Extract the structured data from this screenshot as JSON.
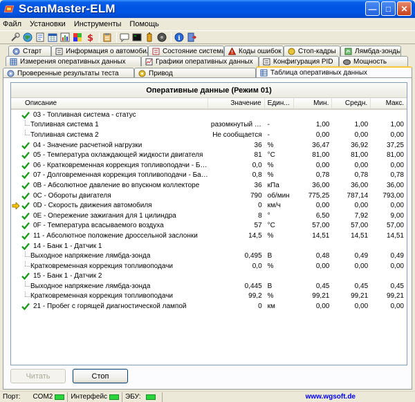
{
  "window": {
    "title": "ScanMaster-ELM"
  },
  "menu": [
    "Файл",
    "Установки",
    "Инструменты",
    "Помощь"
  ],
  "toolbar_icons": [
    "wrench-icon",
    "globe-icon",
    "document-icon",
    "calendar-icon",
    "chart-icon",
    "flag-icon",
    "dollar-icon",
    "separator",
    "clipboard-icon",
    "separator",
    "message-icon",
    "terminal-icon",
    "battery-icon",
    "record-icon",
    "separator",
    "info-icon",
    "exit-icon"
  ],
  "tabs": {
    "row1": [
      {
        "label": "Старт",
        "icon": "gear-icon"
      },
      {
        "label": "Информация о автомобиле",
        "icon": "car-icon"
      },
      {
        "label": "Состояние системы",
        "icon": "status-icon"
      },
      {
        "label": "Коды ошибок",
        "icon": "warning-icon"
      },
      {
        "label": "Стоп-кадры",
        "icon": "freeze-icon"
      },
      {
        "label": "Лямбда-зонды",
        "icon": "sensor-icon"
      }
    ],
    "row2": [
      {
        "label": "Измерения оперативных данных",
        "icon": "grid-icon"
      },
      {
        "label": "Графики оперативных данных",
        "icon": "graph-icon"
      },
      {
        "label": "Конфигурация PID",
        "icon": "config-icon"
      },
      {
        "label": "Мощность",
        "icon": "power-icon"
      }
    ],
    "row3": [
      {
        "label": "Проверенные результаты теста",
        "icon": "test-icon"
      },
      {
        "label": "Привод",
        "icon": "drive-icon"
      },
      {
        "label": "Таблица оперативных данных",
        "icon": "table-icon",
        "active": true
      }
    ]
  },
  "grid": {
    "title": "Оперативные данные (Режим 01)",
    "columns": [
      "Описание",
      "Значение",
      "Един...",
      "Мин.",
      "Средн.",
      "Макс."
    ],
    "rows": [
      {
        "level": 0,
        "check": true,
        "desc": "03 - Топливная система - статус",
        "val": "",
        "unit": "",
        "min": "",
        "avg": "",
        "max": ""
      },
      {
        "level": 1,
        "check": false,
        "desc": "Топливная система 1",
        "val": "разомкнутый к...",
        "unit": "-",
        "min": "1,00",
        "avg": "1,00",
        "max": "1,00"
      },
      {
        "level": 1,
        "check": false,
        "desc": "Топливная система 2",
        "val": "Не сообщается",
        "unit": "-",
        "min": "0,00",
        "avg": "0,00",
        "max": "0,00"
      },
      {
        "level": 0,
        "check": true,
        "desc": "04 - Значение расчетной нагрузки",
        "val": "36",
        "unit": "%",
        "min": "36,47",
        "avg": "36,92",
        "max": "37,25"
      },
      {
        "level": 0,
        "check": true,
        "desc": "05 - Температура охлаждающей жидкости двигателя",
        "val": "81",
        "unit": "°C",
        "min": "81,00",
        "avg": "81,00",
        "max": "81,00"
      },
      {
        "level": 0,
        "check": true,
        "desc": "06 - Кратковременная коррекция топливоподачи - Банк 1",
        "val": "0,0",
        "unit": "%",
        "min": "0,00",
        "avg": "0,00",
        "max": "0,00"
      },
      {
        "level": 0,
        "check": true,
        "desc": "07 - Долговременная коррекция топливоподачи - Банк 1",
        "val": "0,8",
        "unit": "%",
        "min": "0,78",
        "avg": "0,78",
        "max": "0,78"
      },
      {
        "level": 0,
        "check": true,
        "desc": "0B - Абсолютное давление во впускном коллекторе",
        "val": "36",
        "unit": "кПа",
        "min": "36,00",
        "avg": "36,00",
        "max": "36,00"
      },
      {
        "level": 0,
        "check": true,
        "desc": "0C - Обороты двигателя",
        "val": "790",
        "unit": "об/мин",
        "min": "775,25",
        "avg": "787,14",
        "max": "793,00"
      },
      {
        "level": 0,
        "check": true,
        "arrow": true,
        "desc": "0D - Скорость движения автомобиля",
        "val": "0",
        "unit": "км/ч",
        "min": "0,00",
        "avg": "0,00",
        "max": "0,00"
      },
      {
        "level": 0,
        "check": true,
        "desc": "0E - Опережение зажигания для 1 цилиндра",
        "val": "8",
        "unit": "°",
        "min": "6,50",
        "avg": "7,92",
        "max": "9,00"
      },
      {
        "level": 0,
        "check": true,
        "desc": "0F - Температура всасываемого воздуха",
        "val": "57",
        "unit": "°C",
        "min": "57,00",
        "avg": "57,00",
        "max": "57,00"
      },
      {
        "level": 0,
        "check": true,
        "desc": "11 - Абсолютное положение дроссельной заслонки",
        "val": "14,5",
        "unit": "%",
        "min": "14,51",
        "avg": "14,51",
        "max": "14,51"
      },
      {
        "level": 0,
        "check": true,
        "desc": "14 - Банк 1 - Датчик 1",
        "val": "",
        "unit": "",
        "min": "",
        "avg": "",
        "max": ""
      },
      {
        "level": 1,
        "check": false,
        "desc": "Выходное напряжение лямбда-зонда",
        "val": "0,495",
        "unit": "В",
        "min": "0,48",
        "avg": "0,49",
        "max": "0,49"
      },
      {
        "level": 1,
        "check": false,
        "desc": "Кратковременная коррекция топливоподачи",
        "val": "0,0",
        "unit": "%",
        "min": "0,00",
        "avg": "0,00",
        "max": "0,00"
      },
      {
        "level": 0,
        "check": true,
        "desc": "15 - Банк 1 - Датчик 2",
        "val": "",
        "unit": "",
        "min": "",
        "avg": "",
        "max": ""
      },
      {
        "level": 1,
        "check": false,
        "desc": "Выходное напряжение лямбда-зонда",
        "val": "0,445",
        "unit": "В",
        "min": "0,45",
        "avg": "0,45",
        "max": "0,45"
      },
      {
        "level": 1,
        "check": false,
        "desc": "Кратковременная коррекция топливоподачи",
        "val": "99,2",
        "unit": "%",
        "min": "99,21",
        "avg": "99,21",
        "max": "99,21"
      },
      {
        "level": 0,
        "check": true,
        "desc": "21 - Пробег с горящей диагностической лампой",
        "val": "0",
        "unit": "км",
        "min": "0,00",
        "avg": "0,00",
        "max": "0,00"
      }
    ]
  },
  "buttons": {
    "read": "Читать",
    "stop": "Стоп"
  },
  "status": {
    "port_label": "Порт:",
    "port_value": "COM2",
    "interface_label": "Интерфейс",
    "ecu_label": "ЭБУ:",
    "link": "www.wgsoft.de",
    "led_color": "#2ad43c"
  }
}
